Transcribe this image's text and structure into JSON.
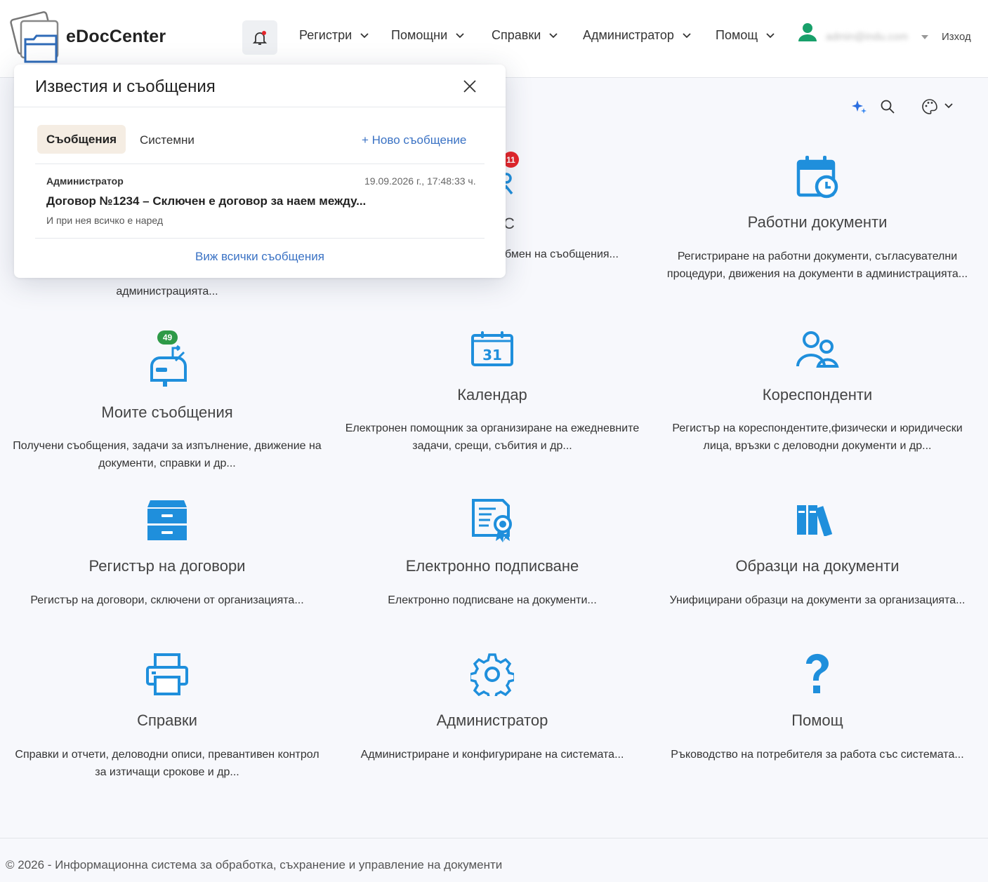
{
  "brand": {
    "name": "eDocCenter"
  },
  "colors": {
    "icon_blue": "#1f8fdc",
    "badge_green": "#2e9a47",
    "badge_red": "#e5252a",
    "link_blue": "#3a72c4",
    "user_green": "#18a06a"
  },
  "nav": {
    "items": [
      {
        "label": "Регистри"
      },
      {
        "label": "Помощни"
      },
      {
        "label": "Справки"
      },
      {
        "label": "Администратор"
      },
      {
        "label": "Помощ"
      }
    ],
    "user_email": "admin@indu.com",
    "logout": "Изход"
  },
  "popup": {
    "title": "Известия и съобщения",
    "tabs": {
      "messages": "Съобщения",
      "system": "Системни"
    },
    "new_message": "+ Ново съобщение",
    "message": {
      "sender": "Администратор",
      "date": "19.09.2026 г., 17:48:33 ч.",
      "subject": "Договор №1234 – Сключен е договор за наем между...",
      "body": "И при нея всичко е наред"
    },
    "view_all": "Виж всички съобщения"
  },
  "cards": {
    "c1": {
      "desc_tail": "администрацията..."
    },
    "c2": {
      "badge": "11",
      "title_tail": "С",
      "desc_tail": "бмен на съобщения..."
    },
    "c3": {
      "title": "Работни документи",
      "desc": "Регистриране на работни документи, съгласувателни процедури, движения на документи в администрацията..."
    },
    "c4": {
      "badge": "49",
      "title": "Моите съобщения",
      "desc": "Получени съобщения, задачи за изпълнение, движение на документи, справки и др..."
    },
    "c5": {
      "title": "Календар",
      "icon_day": "31",
      "desc": "Електронен помощник за организиране на ежедневните задачи, срещи, събития и др..."
    },
    "c6": {
      "title": "Кореспонденти",
      "desc": "Регистър на кореспондентите,физически и юридически лица, връзки с деловодни документи и др..."
    },
    "c7": {
      "title": "Регистър на договори",
      "desc": "Регистър на договори, сключени от организацията..."
    },
    "c8": {
      "title": "Електронно подписване",
      "desc": "Електронно подписване на документи..."
    },
    "c9": {
      "title": "Образци на документи",
      "desc": "Унифицирани образци на документи за организацията..."
    },
    "c10": {
      "title": "Справки",
      "desc": "Справки и отчети, деловодни описи, превантивен контрол за изтичащи срокове и др..."
    },
    "c11": {
      "title": "Администратор",
      "desc": "Администриране и конфигуриране на системата..."
    },
    "c12": {
      "title": "Помощ",
      "desc": "Ръководство на потребителя за работа със системата..."
    }
  },
  "footer": {
    "text": "© 2026 - Информационна система за обработка, съхранение и управление на документи"
  }
}
